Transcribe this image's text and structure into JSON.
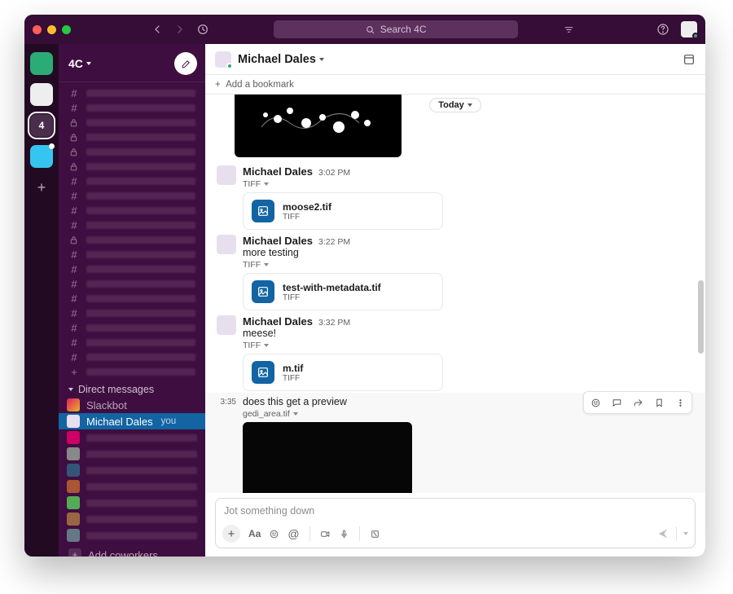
{
  "titlebar": {
    "search_placeholder": "Search 4C"
  },
  "rail": {
    "badge": "4"
  },
  "workspace": {
    "name": "4C"
  },
  "sidebar": {
    "dm_header": "Direct messages",
    "slackbot": "Slackbot",
    "self_dm": {
      "name": "Michael Dales",
      "suffix": "you"
    },
    "add_coworkers": "Add coworkers"
  },
  "channel": {
    "title": "Michael Dales",
    "add_bookmark": "Add a bookmark",
    "today_label": "Today"
  },
  "messages": [
    {
      "type": "preview_top"
    },
    {
      "type": "file_msg",
      "author": "Michael Dales",
      "time": "3:02 PM",
      "tag": "TIFF",
      "file": {
        "name": "moose2.tif",
        "type": "TIFF"
      }
    },
    {
      "type": "text_file_msg",
      "author": "Michael Dales",
      "time": "3:22 PM",
      "text": "more testing",
      "tag": "TIFF",
      "file": {
        "name": "test-with-metadata.tif",
        "type": "TIFF"
      }
    },
    {
      "type": "text_file_msg",
      "author": "Michael Dales",
      "time": "3:32 PM",
      "text": "meese!",
      "tag": "TIFF",
      "file": {
        "name": "m.tif",
        "type": "TIFF"
      }
    },
    {
      "type": "followup_preview",
      "time": "3:35",
      "text": "does this get a preview",
      "tag": "gedi_area.tif"
    }
  ],
  "composer": {
    "placeholder": "Jot something down"
  }
}
